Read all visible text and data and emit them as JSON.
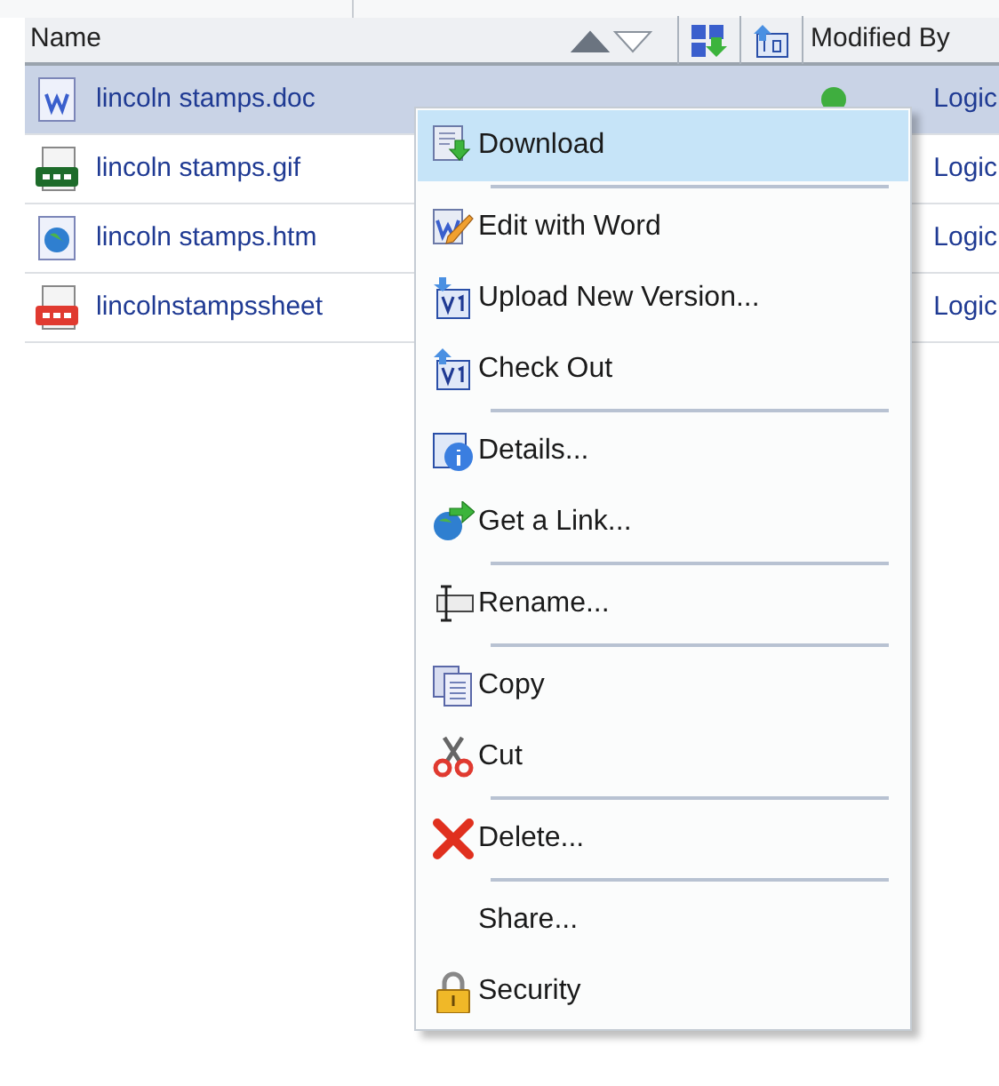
{
  "table": {
    "columns": [
      {
        "label": "Name",
        "sorted_ascending": true
      },
      {
        "label": "Modified By"
      }
    ],
    "rows": [
      {
        "name": "lincoln stamps.doc",
        "kind": "doc",
        "selected": true,
        "status_dot": true,
        "modified_by": "Logic"
      },
      {
        "name": "lincoln stamps.gif",
        "kind": "gif",
        "selected": false,
        "status_dot": false,
        "modified_by": "Logic"
      },
      {
        "name": "lincoln stamps.htm",
        "kind": "htm",
        "selected": false,
        "status_dot": false,
        "modified_by": "Logic"
      },
      {
        "name": "lincolnstampssheet",
        "kind": "jpg",
        "selected": false,
        "status_dot": false,
        "modified_by": "Logic"
      }
    ]
  },
  "context_menu": {
    "items": [
      {
        "label": "Download",
        "kind": "download",
        "selected": true,
        "separator_after": true
      },
      {
        "label": "Edit with Word",
        "kind": "edit",
        "selected": false,
        "separator_after": false
      },
      {
        "label": "Upload New Version...",
        "kind": "upload",
        "selected": false,
        "separator_after": false
      },
      {
        "label": "Check Out",
        "kind": "checkout",
        "selected": false,
        "separator_after": true
      },
      {
        "label": "Details...",
        "kind": "details",
        "selected": false,
        "separator_after": false
      },
      {
        "label": "Get a Link...",
        "kind": "link",
        "selected": false,
        "separator_after": true
      },
      {
        "label": "Rename...",
        "kind": "rename",
        "selected": false,
        "separator_after": true
      },
      {
        "label": "Copy",
        "kind": "copy",
        "selected": false,
        "separator_after": false
      },
      {
        "label": "Cut",
        "kind": "cut",
        "selected": false,
        "separator_after": true
      },
      {
        "label": "Delete...",
        "kind": "delete",
        "selected": false,
        "separator_after": true
      },
      {
        "label": "Share...",
        "kind": "none",
        "selected": false,
        "separator_after": false
      },
      {
        "label": "Security",
        "kind": "security",
        "selected": false,
        "separator_after": false
      }
    ]
  }
}
